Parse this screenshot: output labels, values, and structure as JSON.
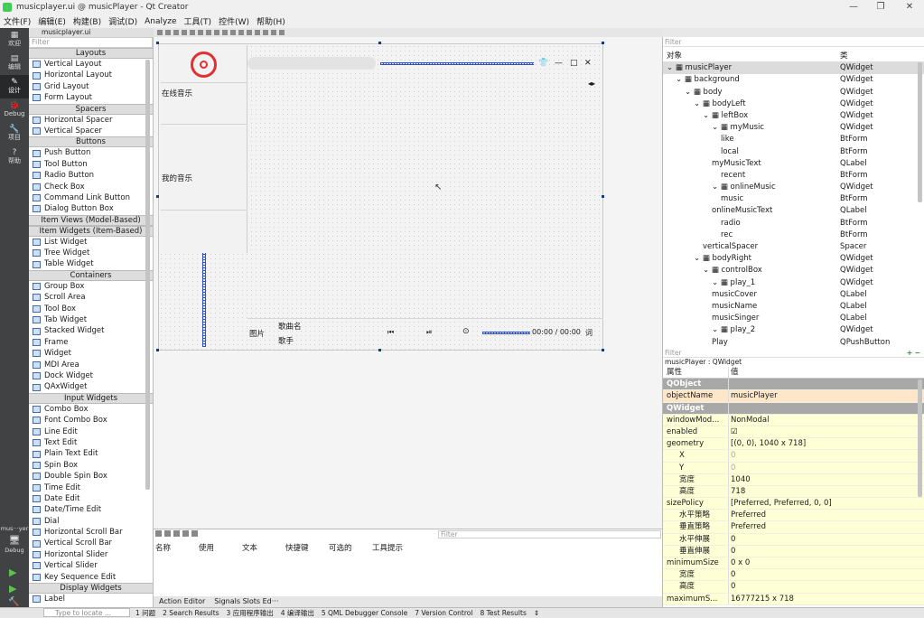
{
  "title": "musicplayer.ui @ musicPlayer - Qt Creator",
  "window_buttons": {
    "minimize": "—",
    "maximize": "❐",
    "close": "✕"
  },
  "menu": [
    "文件(F)",
    "编辑(E)",
    "构建(B)",
    "调试(D)",
    "Analyze",
    "工具(T)",
    "控件(W)",
    "帮助(H)"
  ],
  "modes": [
    {
      "icon": "▦",
      "label": "欢迎"
    },
    {
      "icon": "▤",
      "label": "编辑"
    },
    {
      "icon": "✎",
      "label": "设计"
    },
    {
      "icon": "🐞",
      "label": "Debug"
    },
    {
      "icon": "🔧",
      "label": "项目"
    },
    {
      "icon": "?",
      "label": "帮助"
    }
  ],
  "bottom_modes": {
    "kit": "mus···yer",
    "debug_label": "Debug",
    "run": "▶",
    "debug_run": "▶",
    "build": "🔨"
  },
  "file_tab": "musicplayer.ui",
  "widgetbox": {
    "filter_placeholder": "Filter",
    "sections": [
      {
        "title": "Layouts",
        "items": [
          "Vertical Layout",
          "Horizontal Layout",
          "Grid Layout",
          "Form Layout"
        ]
      },
      {
        "title": "Spacers",
        "items": [
          "Horizontal Spacer",
          "Vertical Spacer"
        ]
      },
      {
        "title": "Buttons",
        "items": [
          "Push Button",
          "Tool Button",
          "Radio Button",
          "Check Box",
          "Command Link Button",
          "Dialog Button Box"
        ]
      },
      {
        "title": "Item Views (Model-Based)",
        "items": []
      },
      {
        "title": "Item Widgets (Item-Based)",
        "items": [
          "List Widget",
          "Tree Widget",
          "Table Widget"
        ]
      },
      {
        "title": "Containers",
        "items": [
          "Group Box",
          "Scroll Area",
          "Tool Box",
          "Tab Widget",
          "Stacked Widget",
          "Frame",
          "Widget",
          "MDI Area",
          "Dock Widget",
          "QAxWidget"
        ]
      },
      {
        "title": "Input Widgets",
        "items": [
          "Combo Box",
          "Font Combo Box",
          "Line Edit",
          "Text Edit",
          "Plain Text Edit",
          "Spin Box",
          "Double Spin Box",
          "Time Edit",
          "Date Edit",
          "Date/Time Edit",
          "Dial",
          "Horizontal Scroll Bar",
          "Vertical Scroll Bar",
          "Horizontal Slider",
          "Vertical Slider",
          "Key Sequence Edit"
        ]
      },
      {
        "title": "Display Widgets",
        "items": [
          "Label"
        ]
      }
    ]
  },
  "form": {
    "online_music": "在线音乐",
    "my_music": "我的音乐",
    "cover": "图片",
    "song_name": "歌曲名",
    "singer": "歌手",
    "time": "00:00 / 00:00",
    "lyrics_btn": "词",
    "btn_skin": "👕",
    "btn_min": "—",
    "btn_max": "□",
    "btn_close": "✕",
    "btn_prev": "⏮",
    "btn_play": "⏯",
    "btn_mode": "⊙",
    "arrows": "◂▸"
  },
  "action_editor": {
    "filter_placeholder": "Filter",
    "columns": [
      "名称",
      "使用",
      "文本",
      "快捷键",
      "可选的",
      "工具提示"
    ],
    "tabs": [
      "Action Editor",
      "Signals  Slots Ed···"
    ]
  },
  "object_inspector": {
    "filter_placeholder": "Filter",
    "header": {
      "object": "对象",
      "class": "类"
    },
    "rows": [
      {
        "name": "musicPlayer",
        "cls": "QWidget",
        "depth": 0,
        "sel": true
      },
      {
        "name": "background",
        "cls": "QWidget",
        "depth": 1
      },
      {
        "name": "body",
        "cls": "QWidget",
        "depth": 2
      },
      {
        "name": "bodyLeft",
        "cls": "QWidget",
        "depth": 3
      },
      {
        "name": "leftBox",
        "cls": "QWidget",
        "depth": 4
      },
      {
        "name": "myMusic",
        "cls": "QWidget",
        "depth": 5
      },
      {
        "name": "like",
        "cls": "BtForm",
        "depth": 6
      },
      {
        "name": "local",
        "cls": "BtForm",
        "depth": 6
      },
      {
        "name": "myMusicText",
        "cls": "QLabel",
        "depth": 5
      },
      {
        "name": "recent",
        "cls": "BtForm",
        "depth": 6
      },
      {
        "name": "onlineMusic",
        "cls": "QWidget",
        "depth": 5
      },
      {
        "name": "music",
        "cls": "BtForm",
        "depth": 6
      },
      {
        "name": "onlineMusicText",
        "cls": "QLabel",
        "depth": 5
      },
      {
        "name": "radio",
        "cls": "BtForm",
        "depth": 6
      },
      {
        "name": "rec",
        "cls": "BtForm",
        "depth": 6
      },
      {
        "name": "verticalSpacer",
        "cls": "Spacer",
        "depth": 4
      },
      {
        "name": "bodyRight",
        "cls": "QWidget",
        "depth": 3
      },
      {
        "name": "controlBox",
        "cls": "QWidget",
        "depth": 4
      },
      {
        "name": "play_1",
        "cls": "QWidget",
        "depth": 5
      },
      {
        "name": "musicCover",
        "cls": "QLabel",
        "depth": 5
      },
      {
        "name": "musicName",
        "cls": "QLabel",
        "depth": 5
      },
      {
        "name": "musicSinger",
        "cls": "QLabel",
        "depth": 5
      },
      {
        "name": "play_2",
        "cls": "QWidget",
        "depth": 5
      },
      {
        "name": "Play",
        "cls": "QPushButton",
        "depth": 5
      }
    ]
  },
  "property_editor": {
    "filter_placeholder": "Filter",
    "context": "musicPlayer : QWidget",
    "header": {
      "property": "属性",
      "value": "值"
    },
    "rows": [
      {
        "n": "QObject",
        "v": "",
        "t": "sec"
      },
      {
        "n": "objectName",
        "v": "musicPlayer",
        "t": "peach"
      },
      {
        "n": "QWidget",
        "v": "",
        "t": "sec"
      },
      {
        "n": "windowMod...",
        "v": "NonModal",
        "t": "yel"
      },
      {
        "n": "enabled",
        "v": "☑",
        "t": "yel"
      },
      {
        "n": "geometry",
        "v": "[(0, 0), 1040 x 718]",
        "t": "yel"
      },
      {
        "n": "X",
        "v": "0",
        "t": "yel"
      },
      {
        "n": "Y",
        "v": "0",
        "t": "yel"
      },
      {
        "n": "宽度",
        "v": "1040",
        "t": "yel"
      },
      {
        "n": "高度",
        "v": "718",
        "t": "yel"
      },
      {
        "n": "sizePolicy",
        "v": "[Preferred, Preferred, 0, 0]",
        "t": "yel"
      },
      {
        "n": "水平策略",
        "v": "Preferred",
        "t": "yel"
      },
      {
        "n": "垂直策略",
        "v": "Preferred",
        "t": "yel"
      },
      {
        "n": "水平伸展",
        "v": "0",
        "t": "yel"
      },
      {
        "n": "垂直伸展",
        "v": "0",
        "t": "yel"
      },
      {
        "n": "minimumSize",
        "v": "0 x 0",
        "t": "yel"
      },
      {
        "n": "宽度",
        "v": "0",
        "t": "yel"
      },
      {
        "n": "高度",
        "v": "0",
        "t": "yel"
      },
      {
        "n": "maximumS...",
        "v": "16777215 x 718",
        "t": "yel"
      }
    ]
  },
  "statusbar": {
    "locate_placeholder": "Type to locate ...",
    "items": [
      "1 问题",
      "2 Search Results",
      "3 应用程序输出",
      "4 编译输出",
      "5 QML Debugger Console",
      "7 Version Control",
      "8 Test Results",
      "⇕"
    ]
  }
}
